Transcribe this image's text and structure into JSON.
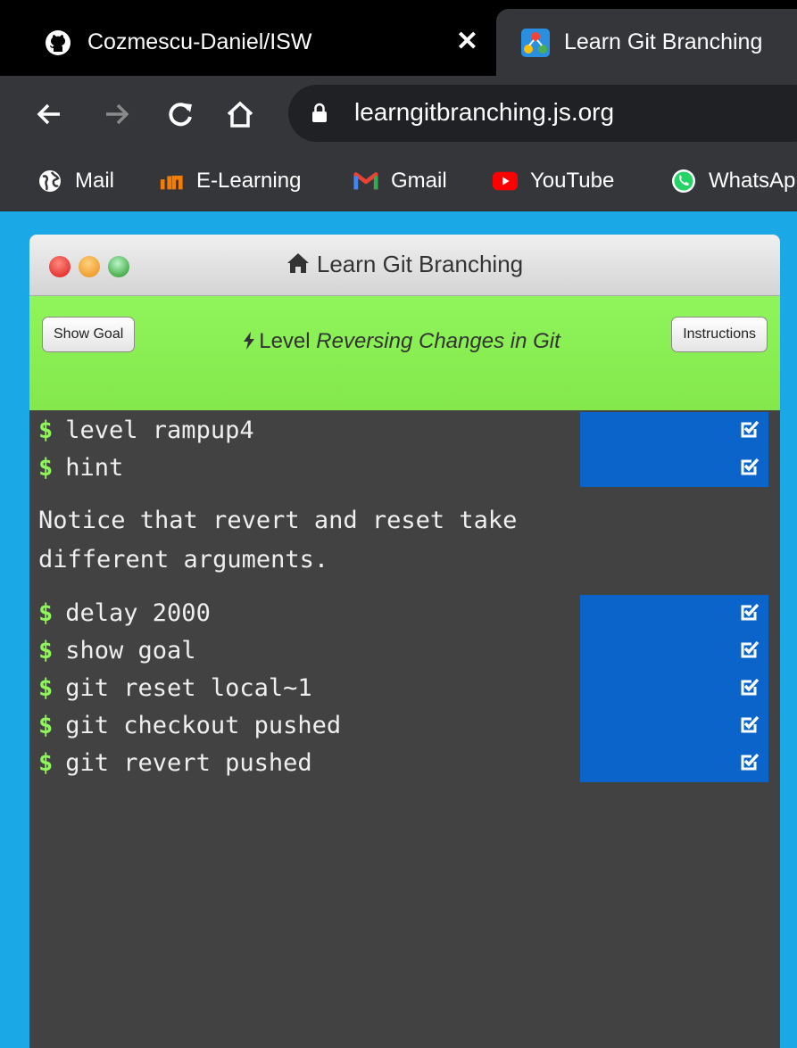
{
  "browser": {
    "tabs": [
      {
        "title": "Cozmescu-Daniel/ISW",
        "close": "✕"
      },
      {
        "title": "Learn Git Branching"
      }
    ],
    "url": "learngitbranching.js.org",
    "bookmarks": [
      {
        "label": "Mail",
        "icon": "globe-icon"
      },
      {
        "label": "E-Learning",
        "icon": "elearning-icon"
      },
      {
        "label": "Gmail",
        "icon": "gmail-icon"
      },
      {
        "label": "YouTube",
        "icon": "youtube-icon"
      },
      {
        "label": "WhatsAp",
        "icon": "whatsapp-icon"
      }
    ]
  },
  "app": {
    "window_title": "Learn Git Branching",
    "show_goal_label": "Show Goal",
    "instructions_label": "Instructions",
    "level_prefix": "Level",
    "level_name": "Reversing Changes in Git"
  },
  "terminal": {
    "prompt": "$",
    "group1": [
      "level rampup4",
      "hint"
    ],
    "hint": "Notice that revert and reset take\ndifferent arguments.",
    "group2": [
      "delay 2000",
      "show goal",
      "git reset local~1",
      "git checkout pushed",
      "git revert pushed"
    ]
  },
  "colors": {
    "page_bg": "#1ba8e6",
    "level_bar": "#8ff55a",
    "terminal_bg": "#424242",
    "check_bg": "#0b64c9",
    "prompt": "#8ff55a"
  }
}
